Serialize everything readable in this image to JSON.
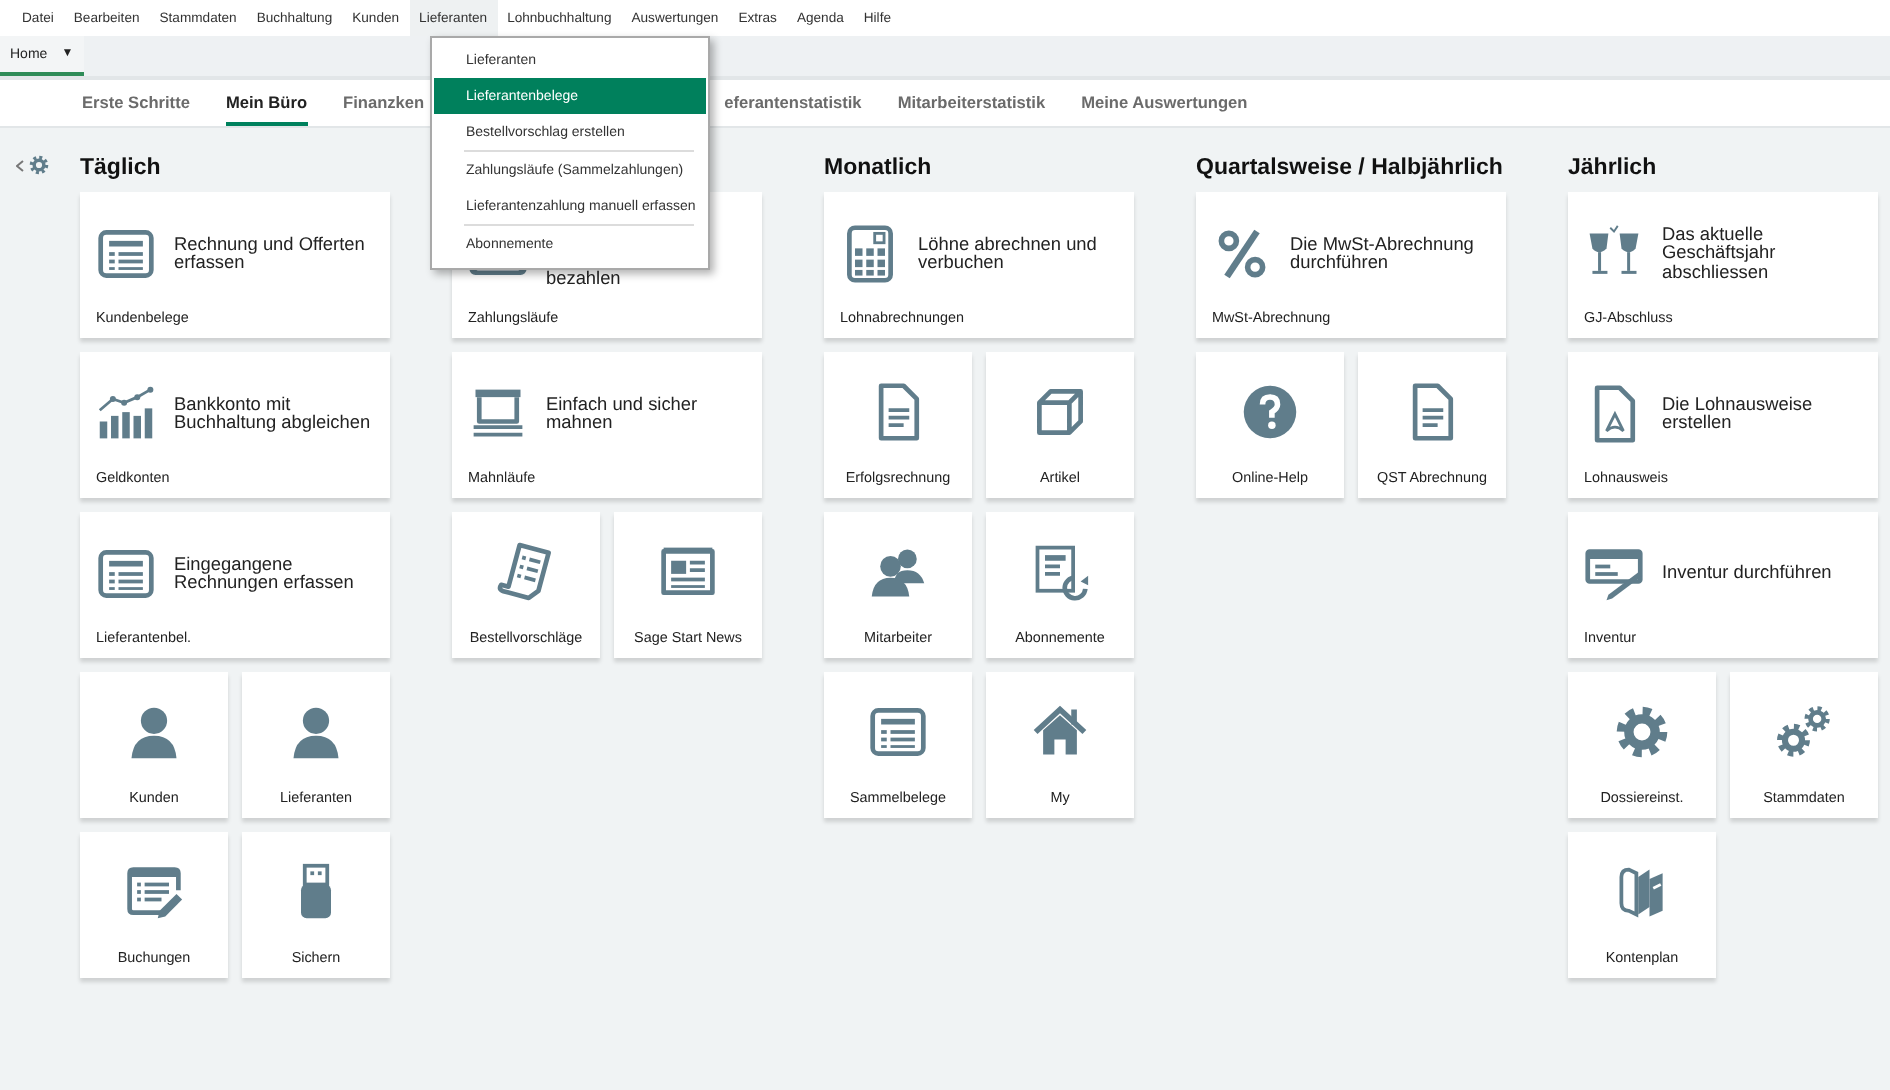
{
  "menu": [
    {
      "label": "Datei",
      "open": false
    },
    {
      "label": "Bearbeiten",
      "open": false
    },
    {
      "label": "Stammdaten",
      "open": false
    },
    {
      "label": "Buchhaltung",
      "open": false
    },
    {
      "label": "Kunden",
      "open": false
    },
    {
      "label": "Lieferanten",
      "open": true
    },
    {
      "label": "Lohnbuchhaltung",
      "open": false
    },
    {
      "label": "Auswertungen",
      "open": false
    },
    {
      "label": "Extras",
      "open": false
    },
    {
      "label": "Agenda",
      "open": false
    },
    {
      "label": "Hilfe",
      "open": false
    }
  ],
  "home_tab": {
    "label": "Home",
    "caret": "▼"
  },
  "tabs": [
    {
      "label": "Erste Schritte",
      "selected": false
    },
    {
      "label": "Mein Büro",
      "selected": true
    },
    {
      "label": "Finanzken",
      "selected": false
    },
    {
      "label": "eferantenstatistik",
      "selected": false
    },
    {
      "label": "Mitarbeiterstatistik",
      "selected": false
    },
    {
      "label": "Meine Auswertungen",
      "selected": false
    }
  ],
  "dropdown": [
    {
      "label": "Lieferanten",
      "selected": false,
      "separator_before": false
    },
    {
      "label": "Lieferantenbelege",
      "selected": true,
      "separator_before": false
    },
    {
      "label": "Bestellvorschlag erstellen",
      "selected": false,
      "separator_before": false
    },
    {
      "label": "Zahlungsläufe (Sammelzahlungen)",
      "selected": false,
      "separator_before": true
    },
    {
      "label": "Lieferantenzahlung manuell erfassen",
      "selected": false,
      "separator_before": false
    },
    {
      "label": "Abonnemente",
      "selected": false,
      "separator_before": true
    }
  ],
  "columns": [
    {
      "heading": "Täglich",
      "rows": [
        {
          "kind": "wide",
          "text": "Rechnung und Offerten\nerfassen",
          "label": "Kundenbelege",
          "covered": false
        },
        {
          "kind": "wide",
          "text": "Bankkonto mit\nBuchhaltung abgleichen",
          "label": "Geldkonten",
          "covered": false
        },
        {
          "kind": "wide",
          "text": "Eingegangene\nRechnungen erfassen",
          "label": "Lieferantenbel.",
          "covered": false
        },
        {
          "kind": "pair",
          "tiles": [
            {
              "label": "Kunden"
            },
            {
              "label": "Lieferanten"
            }
          ]
        },
        {
          "kind": "pair",
          "tiles": [
            {
              "label": "Buchungen"
            },
            {
              "label": "Sichern"
            }
          ]
        }
      ]
    },
    {
      "rows": [
        {
          "kind": "wide",
          "text": "bezahlen",
          "label": "Zahlungsläufe",
          "covered": true
        },
        {
          "kind": "wide",
          "text": "Einfach und sicher\nmahnen",
          "label": "Mahnläufe",
          "covered": false
        },
        {
          "kind": "pair",
          "tiles": [
            {
              "label": "Bestellvorschläge"
            },
            {
              "label": "Sage Start News"
            }
          ]
        }
      ]
    },
    {
      "heading": "Monatlich",
      "rows": [
        {
          "kind": "wide",
          "text": "Löhne abrechnen und\nverbuchen",
          "label": "Lohnabrechnungen",
          "covered": false
        },
        {
          "kind": "pair",
          "tiles": [
            {
              "label": "Erfolgsrechnung"
            },
            {
              "label": "Artikel"
            }
          ]
        },
        {
          "kind": "pair",
          "tiles": [
            {
              "label": "Mitarbeiter"
            },
            {
              "label": "Abonnemente"
            }
          ]
        },
        {
          "kind": "pair",
          "tiles": [
            {
              "label": "Sammelbelege"
            },
            {
              "label": "My"
            }
          ]
        }
      ]
    },
    {
      "heading": "Quartalsweise / Halbjährlich",
      "rows": [
        {
          "kind": "wide",
          "text": "Die MwSt-Abrechnung\ndurchführen",
          "label": "MwSt-Abrechnung",
          "covered": false
        },
        {
          "kind": "pair",
          "tiles": [
            {
              "label": "Online-Help"
            },
            {
              "label": "QST Abrechnung"
            }
          ]
        }
      ]
    },
    {
      "heading": "Jährlich",
      "rows": [
        {
          "kind": "wide",
          "text": "Das aktuelle\nGeschäftsjahr\nabschliessen",
          "label": "GJ-Abschluss",
          "covered": false
        },
        {
          "kind": "wide",
          "text": "Die Lohnausweise\nerstellen",
          "label": "Lohnausweis",
          "covered": false
        },
        {
          "kind": "wide",
          "text": "Inventur durchführen",
          "label": "Inventur",
          "covered": false
        },
        {
          "kind": "pair",
          "tiles": [
            {
              "label": "Dossiereinst."
            },
            {
              "label": "Stammdaten"
            }
          ]
        },
        {
          "kind": "pair",
          "tiles": [
            {
              "label": "Kontenplan"
            }
          ]
        }
      ]
    }
  ]
}
